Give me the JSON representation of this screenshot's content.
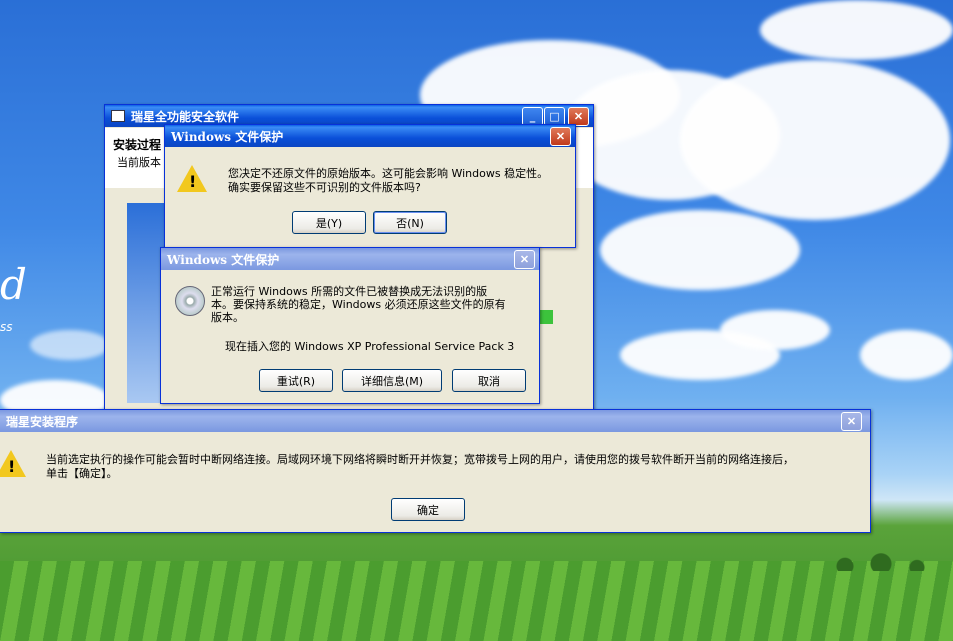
{
  "desktop": {
    "watermark_char": "d",
    "watermark_tail": "ss"
  },
  "installer": {
    "title": "瑞星全功能安全软件",
    "section_title": "安装过程",
    "current_version_label": "当前版本"
  },
  "wfp_confirm": {
    "title": "Windows 文件保护",
    "message_line1": "您决定不还原文件的原始版本。这可能会影响 Windows 稳定性。",
    "message_line2": "确实要保留这些不可识别的文件版本吗?",
    "yes_label": "是(Y)",
    "no_label": "否(N)"
  },
  "wfp_insert": {
    "title": "Windows 文件保护",
    "message_line1": "正常运行 Windows 所需的文件已被替换成无法识别的版",
    "message_line2": "本。要保持系统的稳定，Windows 必须还原这些文件的原有",
    "message_line3": "版本。",
    "insert_prompt": "现在插入您的 Windows XP Professional Service Pack 3",
    "retry_label": "重试(R)",
    "details_label": "详细信息(M)",
    "cancel_label": "取消"
  },
  "setup": {
    "title": "瑞星安装程序",
    "message_line1": "当前选定执行的操作可能会暂时中断网络连接。局域网环境下网络将瞬时断开并恢复；宽带拨号上网的用户，请使用您的拨号软件断开当前的网络连接后，",
    "message_line2": "单击【确定】。",
    "ok_label": "确定"
  },
  "icons": {
    "warning": "warning-icon",
    "cd": "cd-icon",
    "close": "close-icon",
    "minimize": "minimize-icon",
    "maximize": "maximize-icon"
  }
}
